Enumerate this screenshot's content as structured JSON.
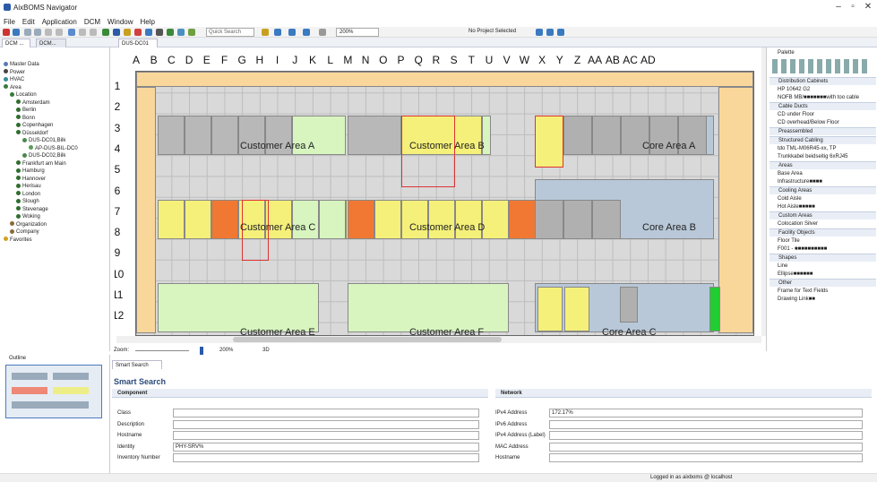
{
  "app": {
    "title": "AixBOMS Navigator",
    "min": "–",
    "max": "▫",
    "close": "✕"
  },
  "menu": [
    "File",
    "Edit",
    "Application",
    "DCM",
    "Window",
    "Help"
  ],
  "toolbar": {
    "quick_search": "Quick Search",
    "zoom": "200%",
    "project": "No Project Selected"
  },
  "tabs": {
    "left1": "DCM ...",
    "left2": "DCM...",
    "editor": "DUS-DC01"
  },
  "tree": [
    {
      "label": "Master Data",
      "lvl": 0,
      "c": "#5a7ab5"
    },
    {
      "label": "Power",
      "lvl": 0,
      "c": "#444"
    },
    {
      "label": "HVAC",
      "lvl": 0,
      "c": "#3a8a9a"
    },
    {
      "label": "Area",
      "lvl": 0,
      "c": "#3a7a3a"
    },
    {
      "label": "Location",
      "lvl": 1,
      "c": "#3a7a3a"
    },
    {
      "label": "Amsterdam",
      "lvl": 2,
      "c": "#2f6e2f"
    },
    {
      "label": "Berlin",
      "lvl": 2,
      "c": "#2f6e2f"
    },
    {
      "label": "Bonn",
      "lvl": 2,
      "c": "#2f6e2f"
    },
    {
      "label": "Copenhagen",
      "lvl": 2,
      "c": "#2f6e2f"
    },
    {
      "label": "Düsseldorf",
      "lvl": 2,
      "c": "#2f6e2f"
    },
    {
      "label": "DUS-DC01,Bilk",
      "lvl": 3,
      "c": "#4a8a4a"
    },
    {
      "label": "AP-DUS-BIL-DC0",
      "lvl": 4,
      "c": "#5b9b5b"
    },
    {
      "label": "DUS-DC02,Bilk",
      "lvl": 3,
      "c": "#4a8a4a"
    },
    {
      "label": "Frankfurt am Main",
      "lvl": 2,
      "c": "#2f6e2f"
    },
    {
      "label": "Hamburg",
      "lvl": 2,
      "c": "#2f6e2f"
    },
    {
      "label": "Hannover",
      "lvl": 2,
      "c": "#2f6e2f"
    },
    {
      "label": "Herisau",
      "lvl": 2,
      "c": "#2f6e2f"
    },
    {
      "label": "London",
      "lvl": 2,
      "c": "#2f6e2f"
    },
    {
      "label": "Slough",
      "lvl": 2,
      "c": "#2f6e2f"
    },
    {
      "label": "Stevenage",
      "lvl": 2,
      "c": "#2f6e2f"
    },
    {
      "label": "Woking",
      "lvl": 2,
      "c": "#2f6e2f"
    },
    {
      "label": "Organization",
      "lvl": 1,
      "c": "#8a6a3a"
    },
    {
      "label": "Company",
      "lvl": 1,
      "c": "#8a6a3a"
    },
    {
      "label": "Favorites",
      "lvl": 0,
      "c": "#d4a020"
    }
  ],
  "columns": [
    "A",
    "B",
    "C",
    "D",
    "E",
    "F",
    "G",
    "H",
    "I",
    "J",
    "K",
    "L",
    "M",
    "N",
    "O",
    "P",
    "Q",
    "R",
    "S",
    "T",
    "U",
    "V",
    "W",
    "X",
    "Y",
    "Z",
    "AA",
    "AB",
    "AC",
    "AD"
  ],
  "rows": [
    "1",
    "2",
    "3",
    "4",
    "5",
    "6",
    "7",
    "8",
    "9",
    "10",
    "11",
    "12"
  ],
  "areas": {
    "a": "Customer Area A",
    "b": "Customer Area B",
    "c": "Customer Area C",
    "d": "Customer Area D",
    "e": "Customer Area E",
    "f": "Customer Area F",
    "core_a": "Core Area A",
    "core_b": "Core Area B",
    "core_c": "Core Area C"
  },
  "zoom": {
    "label": "Zoom:",
    "value": "200%",
    "mode": "3D"
  },
  "palette": {
    "title": "Palette",
    "sections": [
      {
        "title": "Distribution Cabinets",
        "items": [
          "HP 10642 G2",
          "NOFB MB/■■■■■■■with too cable"
        ]
      },
      {
        "title": "Cable Ducts",
        "items": [
          "CD under Floor",
          "CD overhead/Below Floor"
        ]
      },
      {
        "title": "Preassembled",
        "items": []
      },
      {
        "title": "Structured Cabling",
        "items": [
          "tdo TML-M06R45-xx, TP",
          "Trunkkabel beidseitig 6xRJ45"
        ]
      },
      {
        "title": "Areas",
        "items": [
          "Base Area",
          "Infrastructure■■■■"
        ]
      },
      {
        "title": "Cooling Areas",
        "items": [
          "Cold Aisle",
          "Hot Aisle■■■■■"
        ]
      },
      {
        "title": "Custom Areas",
        "items": [
          "Colocation Silver"
        ]
      },
      {
        "title": "Facility Objects",
        "items": [
          "Floor Tile",
          "F001 - ■■■■■■■■■■"
        ]
      },
      {
        "title": "Shapes",
        "items": [
          "Line",
          "Ellipse■■■■■■"
        ]
      },
      {
        "title": "Other",
        "items": [
          "Frame for Text Fields",
          "Drawing Link■■"
        ]
      }
    ]
  },
  "outline": {
    "title": "Outline"
  },
  "search": {
    "tab": "Smart Search",
    "title": "Smart Search",
    "component": "Component",
    "network": "Network",
    "fields_left": [
      {
        "label": "Class",
        "value": ""
      },
      {
        "label": "Description",
        "value": ""
      },
      {
        "label": "Hostname",
        "value": ""
      },
      {
        "label": "Identity",
        "value": "PHY-SRV%"
      },
      {
        "label": "Inventory Number",
        "value": ""
      }
    ],
    "fields_right": [
      {
        "label": "IPv4 Address",
        "value": "172.17%"
      },
      {
        "label": "IPv6 Address",
        "value": ""
      },
      {
        "label": "IPv4 Address (Label)",
        "value": ""
      },
      {
        "label": "MAC Address",
        "value": ""
      },
      {
        "label": "Hostname",
        "value": ""
      }
    ]
  },
  "status": {
    "text": "Logged in as aixboms @ localhost"
  }
}
